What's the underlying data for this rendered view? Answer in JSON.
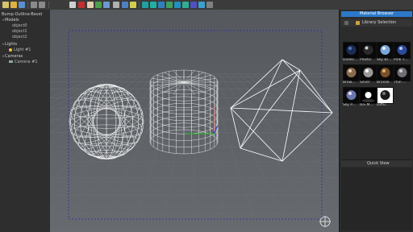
{
  "scene_tree": {
    "root": "Bump-Outline-Bevel",
    "models_label": "Models",
    "models": [
      "object0",
      "object1",
      "object2"
    ],
    "lights_label": "Lights",
    "lights": [
      "Light #1"
    ],
    "cameras_label": "Cameras",
    "cameras": [
      "Camera #1"
    ]
  },
  "material_browser": {
    "title": "Material Browser",
    "library_label": "Library Selection",
    "materials": [
      "Dielec...",
      "Plastic",
      "Sky Bl...",
      "Pink T...",
      "Brow...",
      "Silver",
      "Bronze",
      "Thin ...",
      "Sky P...",
      "IES M...",
      "Diffu..."
    ]
  },
  "quick_view": {
    "title": "Quick View"
  },
  "colors": {
    "accent": "#2c78c8",
    "viewport_bg": "#5d6166",
    "panel_bg": "#2c2c2c"
  }
}
